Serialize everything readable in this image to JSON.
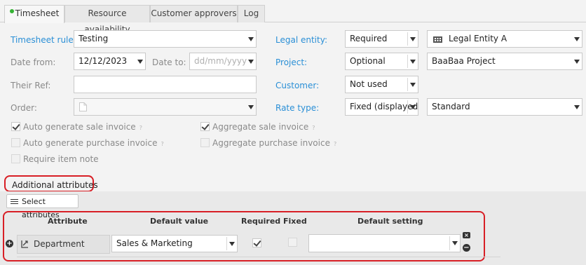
{
  "tabs": [
    "Timesheet",
    "Resource availability",
    "Customer approvers",
    "Log"
  ],
  "form": {
    "timesheet_rule": {
      "label": "Timesheet rule:",
      "value": "Testing"
    },
    "date_from": {
      "label": "Date from:",
      "value": "12/12/2023"
    },
    "date_to": {
      "label": "Date to:",
      "placeholder": "dd/mm/yyyy"
    },
    "their_ref": {
      "label": "Their Ref:",
      "value": ""
    },
    "order": {
      "label": "Order:"
    },
    "legal_entity": {
      "label": "Legal entity:",
      "mode": "Required",
      "value": "Legal Entity A"
    },
    "project": {
      "label": "Project:",
      "mode": "Optional",
      "value": "BaaBaa Project"
    },
    "customer": {
      "label": "Customer:",
      "mode": "Not used"
    },
    "rate_type": {
      "label": "Rate type:",
      "mode": "Fixed (displayed)",
      "value": "Standard"
    }
  },
  "checkboxes": {
    "auto_sale": {
      "label": "Auto generate sale invoice",
      "checked": true
    },
    "auto_purchase": {
      "label": "Auto generate purchase invoice",
      "checked": false
    },
    "require_note": {
      "label": "Require item note",
      "checked": false
    },
    "agg_sale": {
      "label": "Aggregate sale invoice",
      "checked": true
    },
    "agg_purchase": {
      "label": "Aggregate purchase invoice",
      "checked": false
    },
    "help_mark": "?"
  },
  "attributes": {
    "heading": "Additional attributes",
    "select_button": "Select attributes",
    "columns": [
      "Attribute",
      "Default value",
      "Required",
      "Fixed",
      "Default setting"
    ],
    "rows": [
      {
        "attribute": "Department",
        "default_value": "Sales & Marketing",
        "required": true,
        "fixed": false,
        "default_setting": ""
      }
    ]
  },
  "colors": {
    "accent_label": "#2a8fd6",
    "highlight_border": "#d81f26",
    "active_dot": "#34b233"
  }
}
